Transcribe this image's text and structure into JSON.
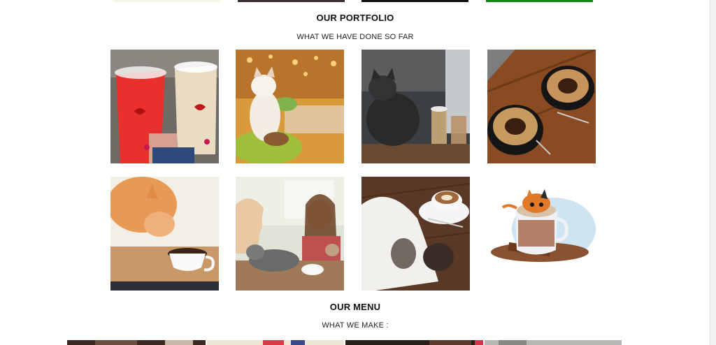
{
  "top_strips": [
    {
      "color": "#f6f6e6"
    },
    {
      "color": "#3a3030"
    },
    {
      "color": "#111111"
    },
    {
      "color": "#148a14"
    }
  ],
  "portfolio": {
    "title": "OUR PORTFOLIO",
    "subtitle": "WHAT WE HAVE DONE SO FAR",
    "images": [
      {
        "subject": "cat-face-iced-drinks"
      },
      {
        "subject": "cat-in-cafe"
      },
      {
        "subject": "cat-with-iced-coffee"
      },
      {
        "subject": "cat-latte-art"
      },
      {
        "subject": "cat-sniffing-coffee-cup"
      },
      {
        "subject": "cafe-girls-with-cats"
      },
      {
        "subject": "cat-sleeping-by-latte"
      },
      {
        "subject": "cat-in-mug-illustration"
      }
    ]
  },
  "menu": {
    "title": "OUR MENU",
    "subtitle": "WHAT WE MAKE :"
  }
}
